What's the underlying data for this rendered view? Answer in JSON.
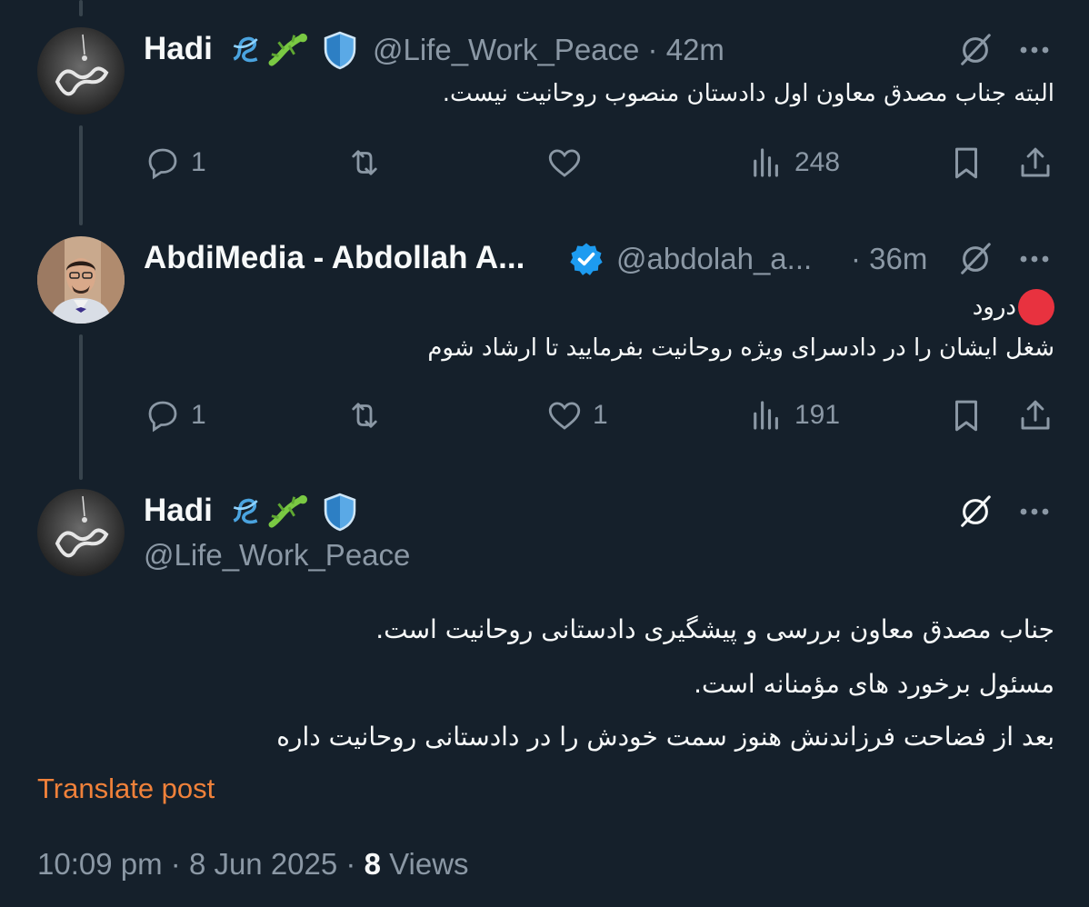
{
  "tweets": [
    {
      "name": "Hadi",
      "handle": "@Life_Work_Peace",
      "sep": "·",
      "time": "42m",
      "lines": [
        "البته جناب مصدق معاون اول دادستان منصوب روحانیت نیست."
      ],
      "replies": "1",
      "retweets": "",
      "likes": "",
      "views": "248"
    },
    {
      "name": "AbdiMedia - Abdollah A...",
      "handle": "@abdolah_a...",
      "sep": "·",
      "time": "36m",
      "lines": [
        "درود",
        "شغل ایشان را در دادسرای ویژه روحانیت بفرمایید تا ارشاد شوم"
      ],
      "replies": "1",
      "retweets": "",
      "likes": "1",
      "views": "191"
    }
  ],
  "main_tweet": {
    "name": "Hadi",
    "handle": "@Life_Work_Peace",
    "lines": [
      "جناب مصدق معاون بررسی و پیشگیری دادستانی روحانیت است.",
      "مسئول برخورد های مؤمنانه است.",
      "بعد از فضاحت فرزاندنش هنوز سمت خودش را در دادستانی روحانیت داره"
    ],
    "translate_label": "Translate post",
    "time": "10:09 pm",
    "date": "8 Jun 2025",
    "views_count": "8",
    "views_label": "Views",
    "sep": "·"
  },
  "icons": {
    "badges": [
      "knot-icon",
      "lizard-icon",
      "shield-icon"
    ],
    "verified": "verified-badge-icon",
    "grok": "grok-icon",
    "more": "more-icon"
  },
  "colors": {
    "background": "#15202b",
    "text": "#f7f9f9",
    "muted": "#8b98a5",
    "verified": "#1d9bf0",
    "translate": "#f0813a",
    "red_dot": "#e8323f"
  }
}
